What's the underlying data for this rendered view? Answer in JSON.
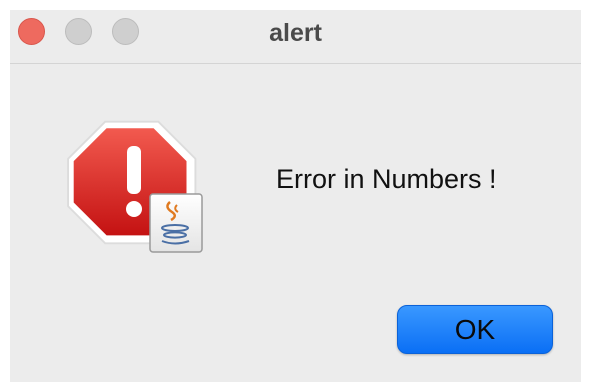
{
  "window": {
    "title": "alert"
  },
  "dialog": {
    "message": "Error in Numbers !",
    "ok_label": "OK",
    "icon": "error-stop-sign-with-java-badge"
  },
  "colors": {
    "close_button": "#ee6a5f",
    "inactive_button": "#cfcfcf",
    "ok_button": "#1a80fb",
    "stop_sign": "#d42020"
  }
}
